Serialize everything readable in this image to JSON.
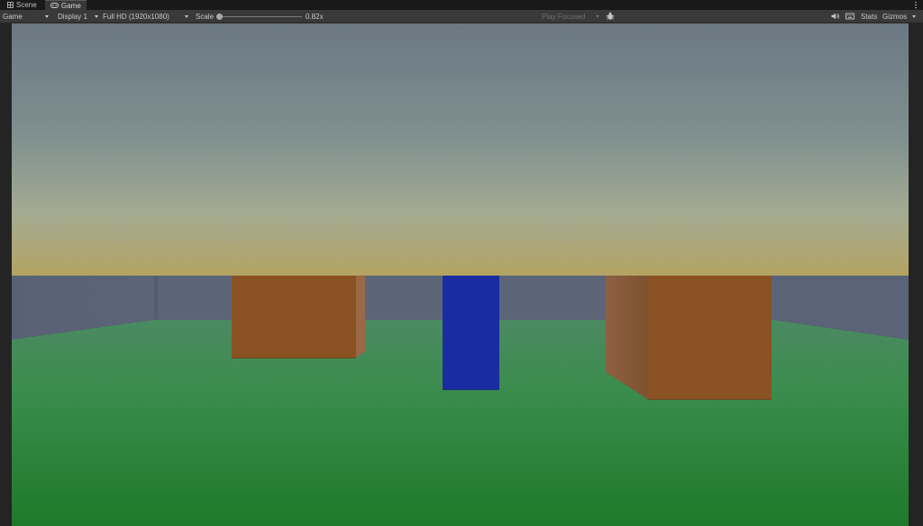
{
  "tabs": [
    {
      "label": "Scene",
      "icon": "grid-icon",
      "active": false
    },
    {
      "label": "Game",
      "icon": "gamepad-icon",
      "active": true
    }
  ],
  "toolbar": {
    "mode": "Game",
    "display": "Display 1",
    "resolution": "Full HD (1920x1080)",
    "scale_label": "Scale",
    "scale_value": "0.82x",
    "play_focused": "Play Focused",
    "stats_label": "Stats",
    "gizmos_label": "Gizmos"
  },
  "colors": {
    "sky_top": "#6c7a84",
    "sky_horizon": "#a8a46c",
    "ground_far": "#4a8a5c",
    "ground_near": "#1e7c2c",
    "wall": "#5a6478",
    "cube_orange": "#8c5222",
    "pillar_blue": "#1a2ca0"
  }
}
